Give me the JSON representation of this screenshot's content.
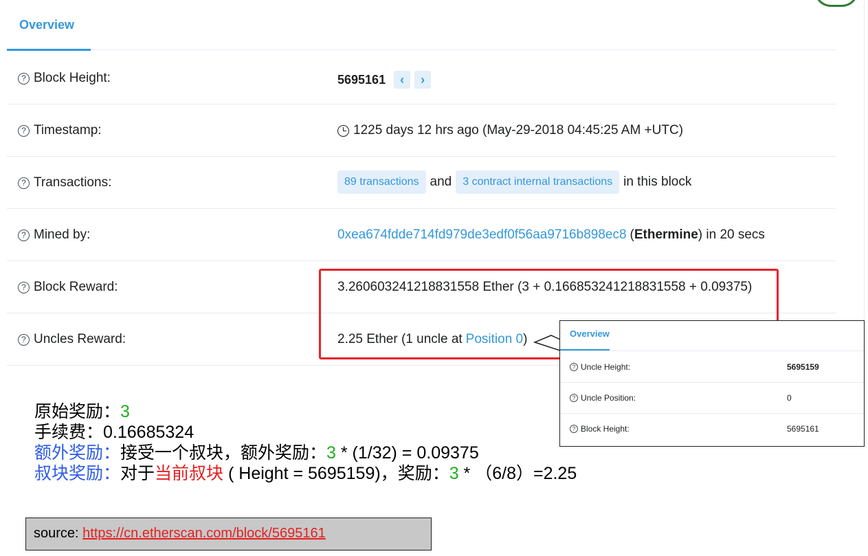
{
  "overview": {
    "tab_label": "Overview",
    "rows": [
      {
        "label": "Block Height:"
      },
      {
        "label": "Timestamp:"
      },
      {
        "label": "Transactions:"
      },
      {
        "label": "Mined by:"
      },
      {
        "label": "Block Reward:"
      },
      {
        "label": "Uncles Reward:"
      }
    ],
    "block_height": "5695161",
    "timestamp": "1225 days 12 hrs ago (May-29-2018 04:45:25 AM +UTC)",
    "transactions": {
      "tx_pill": "89 transactions",
      "and": "and",
      "internal_pill": "3 contract internal transactions",
      "suffix": "in this block"
    },
    "mined_by": {
      "address": "0xea674fdde714fd979de3edf0f56aa9716b898ec8",
      "open_paren": "(",
      "miner_name": "Ethermine",
      "suffix": ") in 20 secs"
    },
    "block_reward": "3.260603241218831558 Ether (3 + 0.166853241218831558 + 0.09375)",
    "uncles_reward": {
      "prefix": "2.25 Ether (1 uncle at",
      "link": "Position 0",
      "suffix": ")"
    }
  },
  "uncle_popup": {
    "tab_label": "Overview",
    "rows": [
      {
        "label": "Uncle Height:",
        "value": "5695159"
      },
      {
        "label": "Uncle Position:",
        "value": "0"
      },
      {
        "label": "Block Height:",
        "value": "5695161"
      }
    ]
  },
  "notes": {
    "line1": {
      "label": "原始奖励：",
      "value": "3"
    },
    "line2": {
      "label": "手续费：",
      "value": "0.16685324"
    },
    "line3": {
      "label": "额外奖励：",
      "text": "接受一个叔块，额外奖励：",
      "num": "3",
      "formula": " * (1/32) = 0.09375"
    },
    "line4": {
      "label": "叔块奖励：",
      "text1": "对于",
      "highlight": "当前叔块",
      "formula1": " ( Height = 5695159)，",
      "text2": "奖励：",
      "num": "3",
      "formula2": " * （6/8）=2.25"
    }
  },
  "source": {
    "label": "source: ",
    "url": "https://cn.etherscan.com/block/5695161"
  },
  "colors": {
    "link_blue": "#3498db",
    "pill_bg": "#e3effa",
    "highlight_red": "#e8232b",
    "note_green": "#1fb11f",
    "note_blue": "#2e5be8",
    "note_red": "#e32020"
  },
  "icons": {
    "help": "question-circle-icon",
    "clock": "clock-icon",
    "prev": "chevron-left-icon",
    "next": "chevron-right-icon"
  }
}
